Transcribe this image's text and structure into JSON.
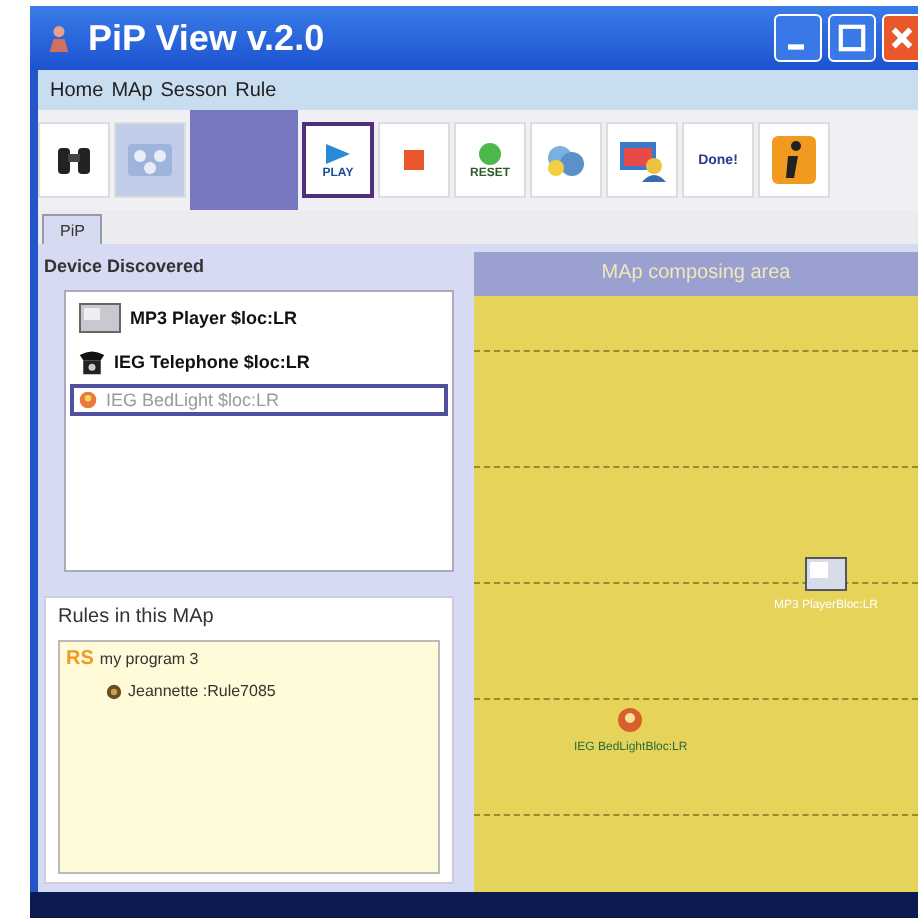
{
  "window": {
    "title": "PiP View v.2.0"
  },
  "menu": [
    "Home",
    "MAp",
    "Sesson",
    "Rule"
  ],
  "tools": [
    {
      "kind": "binoculars",
      "selected": false
    },
    {
      "kind": "network",
      "selected": false
    }
  ],
  "actions": [
    {
      "kind": "play",
      "label": "PLAY",
      "selected": true
    },
    {
      "kind": "stop",
      "selected": false
    },
    {
      "kind": "reset",
      "label": "RESET",
      "selected": false
    },
    {
      "kind": "cloud",
      "selected": false
    },
    {
      "kind": "monitor",
      "selected": false
    },
    {
      "kind": "text",
      "label": "Done!",
      "selected": false
    },
    {
      "kind": "info",
      "selected": false
    }
  ],
  "tabs": [
    {
      "label": "PiP",
      "selected": true
    }
  ],
  "devices": {
    "title": "Device Discovered",
    "items": [
      {
        "kind": "mp3",
        "label": "MP3 Player $loc:LR",
        "selected": false
      },
      {
        "kind": "phone",
        "label": "IEG Telephone $loc:LR",
        "selected": false
      },
      {
        "kind": "lamp",
        "label": "IEG BedLight $loc:LR",
        "selected": true
      }
    ]
  },
  "rules": {
    "title": "Rules in this MAp",
    "tree": [
      {
        "badge": "RS",
        "label": "my program 3",
        "children": [
          {
            "label": "Jeannette :Rule7085"
          }
        ]
      }
    ]
  },
  "map": {
    "title": "MAp composing area",
    "nodes": [
      {
        "kind": "mp3",
        "label": "MP3 PlayerBloc:LR"
      },
      {
        "kind": "lamp",
        "label": "IEG BedLightBloc:LR"
      }
    ]
  }
}
